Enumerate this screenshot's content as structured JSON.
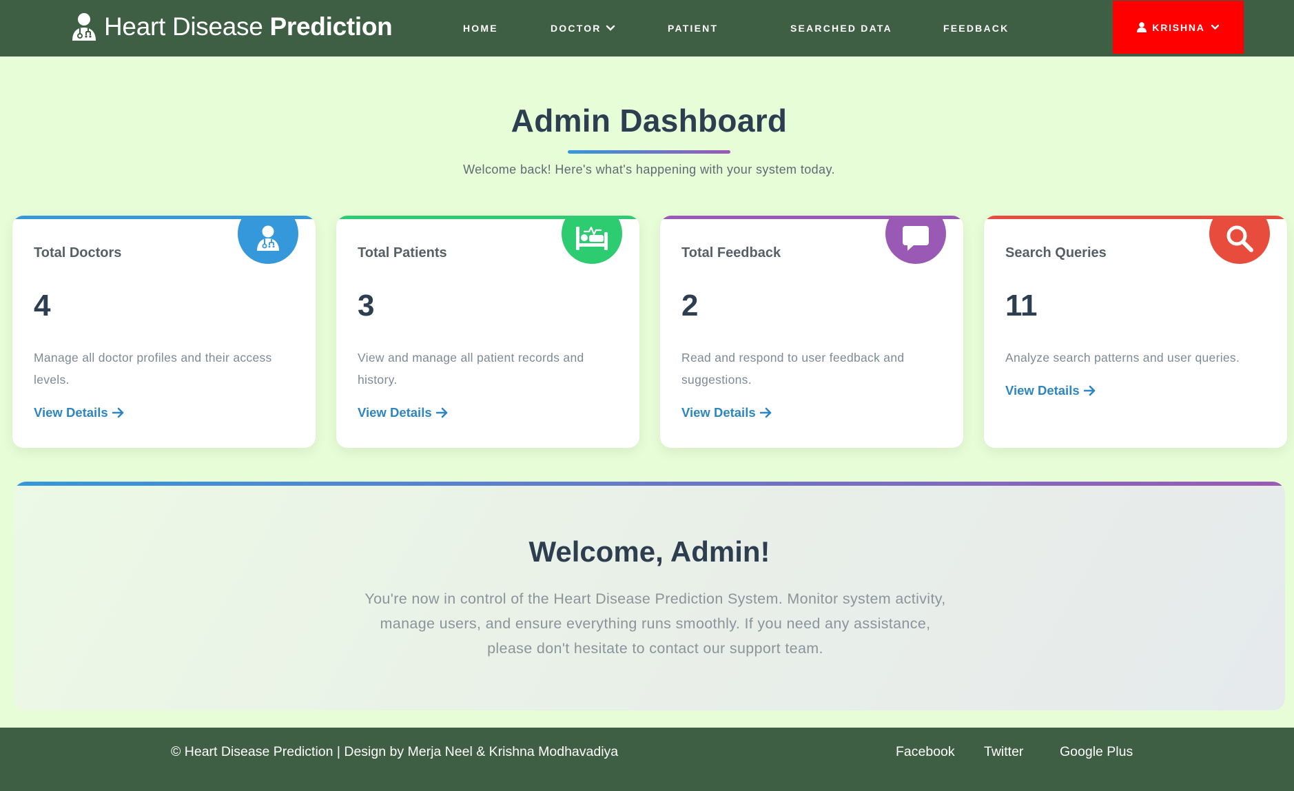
{
  "header": {
    "brand_light": "Heart Disease",
    "brand_bold": "Prediction",
    "nav": {
      "home": "HOME",
      "doctor": "DOCTOR",
      "patient": "PATIENT",
      "searched_data": "SEARCHED DATA",
      "feedback": "FEEDBACK"
    },
    "user": "KRISHNA",
    "user_button_color": "#ff0000",
    "bar_color": "#3f5f44"
  },
  "main": {
    "title": "Admin Dashboard",
    "subtitle": "Welcome back! Here's what's happening with your system today."
  },
  "cards": [
    {
      "label": "Total Doctors",
      "value": "4",
      "description": "Manage all doctor profiles and their access levels.",
      "link": "View Details",
      "icon": "doctor-icon",
      "color": "#3498db"
    },
    {
      "label": "Total Patients",
      "value": "3",
      "description": "View and manage all patient records and history.",
      "link": "View Details",
      "icon": "patient-bed-icon",
      "color": "#2ecc71"
    },
    {
      "label": "Total Feedback",
      "value": "2",
      "description": "Read and respond to user feedback and suggestions.",
      "link": "View Details",
      "icon": "comment-icon",
      "color": "#9b59b6"
    },
    {
      "label": "Search Queries",
      "value": "11",
      "description": "Analyze search patterns and user queries.",
      "link": "View Details",
      "icon": "search-icon",
      "color": "#e74c3c"
    }
  ],
  "welcome": {
    "title": "Welcome, Admin!",
    "text": "You're now in control of the Heart Disease Prediction System. Monitor system activity, manage users, and ensure everything runs smoothly. If you need any assistance, please don't hesitate to contact our support team."
  },
  "footer": {
    "copyright": "© Heart Disease Prediction | Design by Merja Neel & Krishna Modhavadiya",
    "links": [
      "Facebook",
      "Twitter",
      "Google Plus"
    ]
  }
}
